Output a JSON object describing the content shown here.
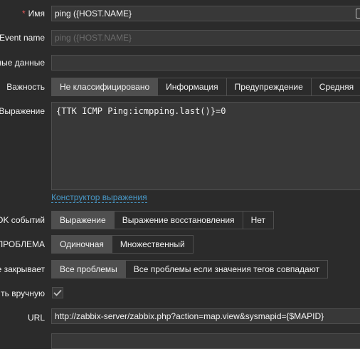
{
  "form": {
    "name": {
      "label": "Имя",
      "required_mark": "*",
      "value": "ping ({HOST.NAME}"
    },
    "event_name": {
      "label": "Event name",
      "placeholder": "ping ({HOST.NAME}"
    },
    "opdata": {
      "label": "ные данные",
      "value": ""
    },
    "severity": {
      "label": "Важность",
      "options": [
        "Не классифицировано",
        "Информация",
        "Предупреждение",
        "Средняя"
      ],
      "selected": "Не классифицировано"
    },
    "expression": {
      "label": "Выражение",
      "value": "{TTK ICMP Ping:icmpping.last()}=0",
      "constructor_link": "Конструктор выражения"
    },
    "ok_event": {
      "label": "OK событий",
      "options": [
        "Выражение",
        "Выражение восстановления",
        "Нет"
      ],
      "selected": "Выражение"
    },
    "problem_mode": {
      "label": "ПРОБЛЕМА",
      "options": [
        "Одиночная",
        "Множественный"
      ],
      "selected": "Одиночная"
    },
    "ok_closes": {
      "label": "е закрывает",
      "options": [
        "Все проблемы",
        "Все проблемы если значения тегов совпадают"
      ],
      "selected": "Все проблемы"
    },
    "manual_close": {
      "label": "ть вручную",
      "checked": true
    },
    "url": {
      "label": "URL",
      "value": "http://zabbix-server/zabbix.php?action=map.view&sysmapid={$MAPID}"
    }
  }
}
